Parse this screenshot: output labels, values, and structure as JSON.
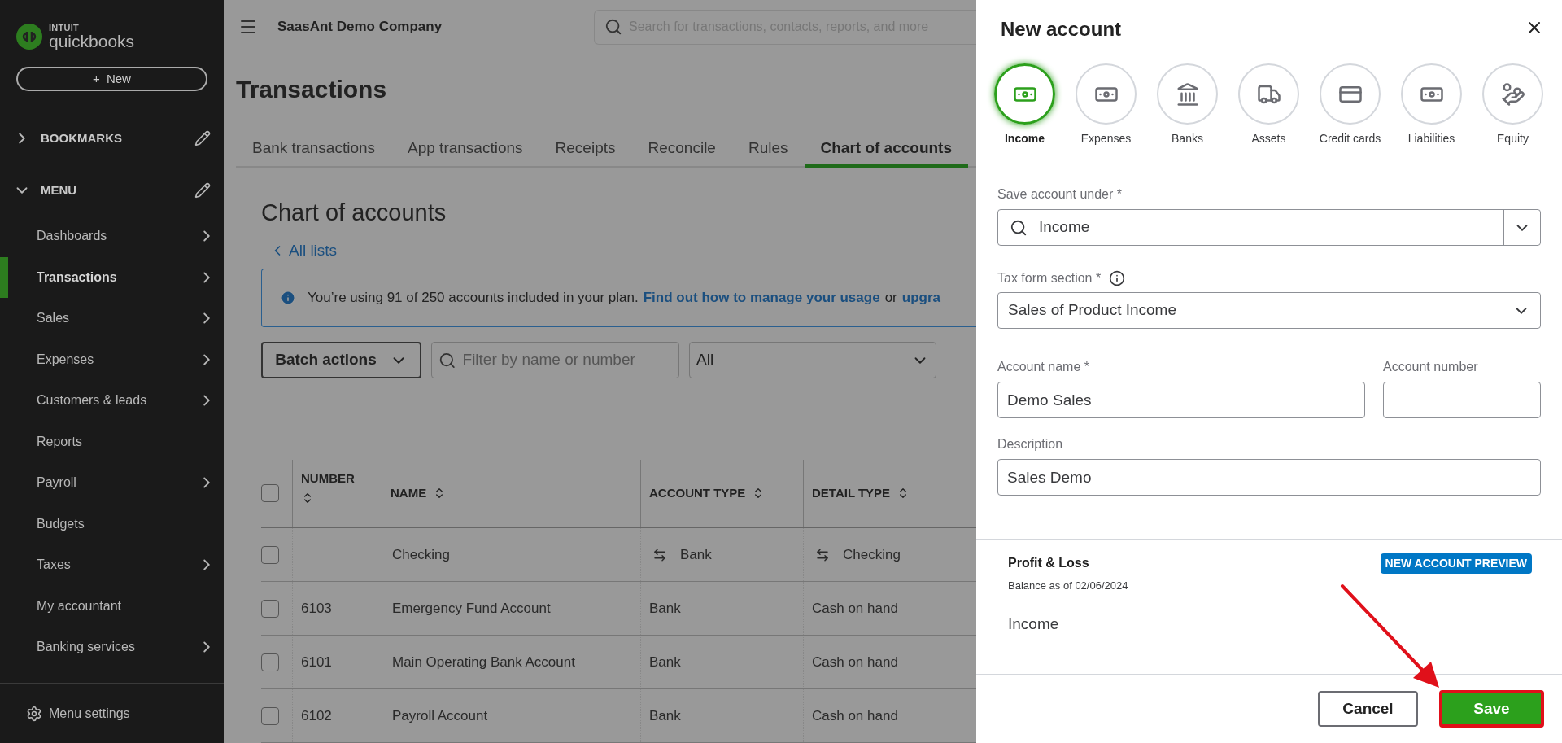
{
  "sidebar": {
    "logo": {
      "brand": "INTUIT",
      "product": "quickbooks"
    },
    "new_button": "New",
    "new_button_icon": "+",
    "sections": [
      {
        "label": "BOOKMARKS",
        "expanded": false
      },
      {
        "label": "MENU",
        "expanded": true
      }
    ],
    "items": [
      {
        "label": "Dashboards",
        "selected": false,
        "submenu": true
      },
      {
        "label": "Transactions",
        "selected": true,
        "submenu": true
      },
      {
        "label": "Sales",
        "selected": false,
        "submenu": true
      },
      {
        "label": "Expenses",
        "selected": false,
        "submenu": true
      },
      {
        "label": "Customers & leads",
        "selected": false,
        "submenu": true
      },
      {
        "label": "Reports",
        "selected": false,
        "submenu": false
      },
      {
        "label": "Payroll",
        "selected": false,
        "submenu": true
      },
      {
        "label": "Budgets",
        "selected": false,
        "submenu": false
      },
      {
        "label": "Taxes",
        "selected": false,
        "submenu": true
      },
      {
        "label": "My accountant",
        "selected": false,
        "submenu": false
      },
      {
        "label": "Banking services",
        "selected": false,
        "submenu": true
      }
    ],
    "settings": "Menu settings"
  },
  "topbar": {
    "company": "SaasAnt Demo Company",
    "search": {
      "placeholder": "Search for transactions, contacts, reports, and more"
    }
  },
  "page": {
    "title": "Transactions",
    "tabs": [
      {
        "label": "Bank transactions",
        "selected": false
      },
      {
        "label": "App transactions",
        "selected": false
      },
      {
        "label": "Receipts",
        "selected": false
      },
      {
        "label": "Reconcile",
        "selected": false
      },
      {
        "label": "Rules",
        "selected": false
      },
      {
        "label": "Chart of accounts",
        "selected": true
      }
    ],
    "heading": "Chart of accounts",
    "back_link": "All lists",
    "banner": {
      "text": "You’re using 91 of 250 accounts included in your plan.",
      "link": "Find out how to manage your usage",
      "joiner": "or",
      "link2": "upgra"
    },
    "batch_actions": "Batch actions",
    "filter": {
      "placeholder": "Filter by name or number"
    },
    "type_filter": "All",
    "table": {
      "select_all": {
        "checked": false
      },
      "columns": [
        "NUMBER",
        "NAME",
        "ACCOUNT TYPE",
        "DETAIL TYPE"
      ],
      "rows": [
        {
          "checked": false,
          "kind": "bank-feed",
          "number": "",
          "name": "Checking",
          "account_type": "Bank",
          "detail_type": "Checking"
        },
        {
          "checked": false,
          "kind": "plain",
          "number": "6103",
          "name": "Emergency Fund Account",
          "account_type": "Bank",
          "detail_type": "Cash on hand"
        },
        {
          "checked": false,
          "kind": "plain",
          "number": "6101",
          "name": "Main Operating Bank Account",
          "account_type": "Bank",
          "detail_type": "Cash on hand"
        },
        {
          "checked": false,
          "kind": "plain",
          "number": "6102",
          "name": "Payroll Account",
          "account_type": "Bank",
          "detail_type": "Cash on hand"
        }
      ]
    }
  },
  "panel": {
    "title": "New account",
    "account_types": [
      {
        "label": "Income",
        "selected": true
      },
      {
        "label": "Expenses",
        "selected": false
      },
      {
        "label": "Banks",
        "selected": false
      },
      {
        "label": "Assets",
        "selected": false
      },
      {
        "label": "Credit cards",
        "selected": false
      },
      {
        "label": "Liabilities",
        "selected": false
      },
      {
        "label": "Equity",
        "selected": false
      }
    ],
    "save_under": {
      "label": "Save account under *",
      "value": "Income"
    },
    "tax_form": {
      "label": "Tax form section *",
      "value": "Sales of Product Income"
    },
    "account_name": {
      "label": "Account name *",
      "value": "Demo Sales"
    },
    "account_number": {
      "label": "Account number"
    },
    "description": {
      "label": "Description",
      "value": "Sales Demo"
    },
    "preview": {
      "title": "Profit & Loss",
      "subtitle": "Balance as of 02/06/2024",
      "badge": "NEW ACCOUNT PREVIEW",
      "section": "Income"
    },
    "cancel": "Cancel",
    "save": {
      "label": "Save",
      "highlighted": true
    }
  }
}
